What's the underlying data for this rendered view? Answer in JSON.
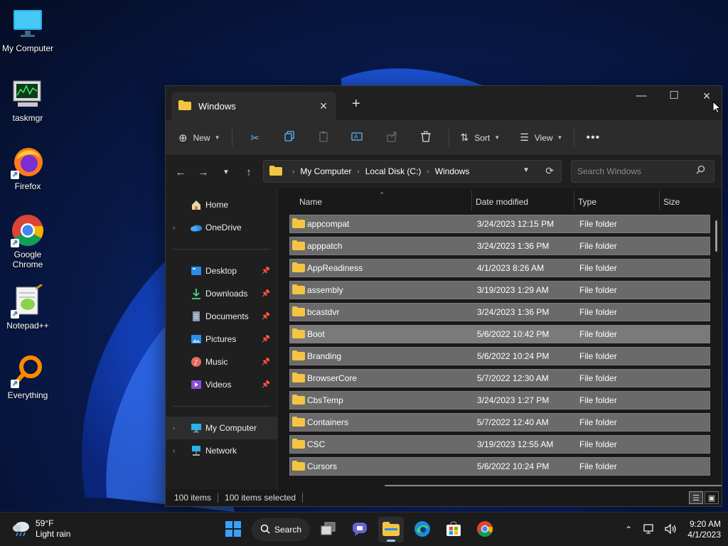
{
  "desktop": {
    "icons": [
      {
        "label": "My Computer",
        "icon": "monitor-icon"
      },
      {
        "label": "taskmgr",
        "icon": "task-manager-icon"
      },
      {
        "label": "Firefox",
        "icon": "firefox-icon"
      },
      {
        "label": "Google Chrome",
        "icon": "chrome-icon"
      },
      {
        "label": "Notepad++",
        "icon": "notepadpp-icon"
      },
      {
        "label": "Everything",
        "icon": "everything-icon"
      }
    ]
  },
  "window": {
    "tab_title": "Windows",
    "toolbar": {
      "new_label": "New",
      "sort_label": "Sort",
      "view_label": "View"
    },
    "breadcrumbs": [
      "My Computer",
      "Local Disk (C:)",
      "Windows"
    ],
    "search_placeholder": "Search Windows",
    "nav": {
      "home": "Home",
      "onedrive": "OneDrive",
      "quick": [
        "Desktop",
        "Downloads",
        "Documents",
        "Pictures",
        "Music",
        "Videos"
      ],
      "mycomputer": "My Computer",
      "network": "Network"
    },
    "columns": {
      "name": "Name",
      "date": "Date modified",
      "type": "Type",
      "size": "Size"
    },
    "files": [
      {
        "name": "appcompat",
        "date": "3/24/2023 12:15 PM",
        "type": "File folder"
      },
      {
        "name": "apppatch",
        "date": "3/24/2023 1:36 PM",
        "type": "File folder"
      },
      {
        "name": "AppReadiness",
        "date": "4/1/2023 8:26 AM",
        "type": "File folder"
      },
      {
        "name": "assembly",
        "date": "3/19/2023 1:29 AM",
        "type": "File folder"
      },
      {
        "name": "bcastdvr",
        "date": "3/24/2023 1:36 PM",
        "type": "File folder"
      },
      {
        "name": "Boot",
        "date": "5/6/2022 10:42 PM",
        "type": "File folder"
      },
      {
        "name": "Branding",
        "date": "5/6/2022 10:24 PM",
        "type": "File folder"
      },
      {
        "name": "BrowserCore",
        "date": "5/7/2022 12:30 AM",
        "type": "File folder"
      },
      {
        "name": "CbsTemp",
        "date": "3/24/2023 1:27 PM",
        "type": "File folder"
      },
      {
        "name": "Containers",
        "date": "5/7/2022 12:40 AM",
        "type": "File folder"
      },
      {
        "name": "CSC",
        "date": "3/19/2023 12:55 AM",
        "type": "File folder"
      },
      {
        "name": "Cursors",
        "date": "5/6/2022 10:24 PM",
        "type": "File folder"
      }
    ],
    "status": {
      "items": "100 items",
      "selected": "100 items selected"
    }
  },
  "taskbar": {
    "weather_temp": "59°F",
    "weather_desc": "Light rain",
    "search_label": "Search",
    "time": "9:20 AM",
    "date": "4/1/2023"
  },
  "colors": {
    "folder": "#f4c542",
    "accent": "#4cc2ff"
  }
}
